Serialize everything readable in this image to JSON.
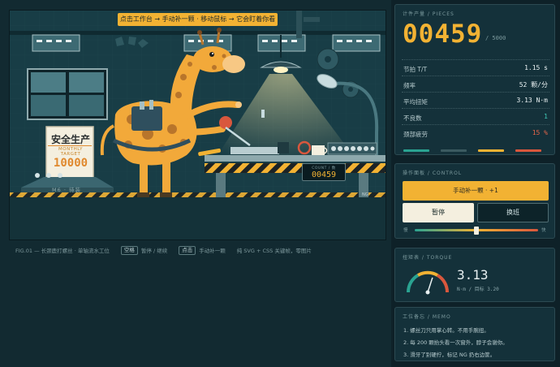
{
  "banner": {
    "text": "点击工作台 → 手动补一颗 · 移动鼠标 → 它会盯着你看"
  },
  "scene": {
    "sign_title": "安全生产",
    "sign_subtitle": "MONTHLY TARGET",
    "sign_number": "10000",
    "cart_label": "M6 · 待装",
    "count_label": "COUNT / 数",
    "count_value": "00459",
    "ng_label": "NG"
  },
  "caption": {
    "figure": "FIG.01 — 长颈鹿打螺丝 · 单轴流水工位",
    "key1": "空格",
    "action1": "暂停 / 继续",
    "key2": "点击",
    "action2": "手动补一颗",
    "note": "纯 SVG + CSS 关键帧，零图片"
  },
  "pieces": {
    "title": "计件产量 / PIECES",
    "value": "00459",
    "target": "/ 5000",
    "stats": [
      {
        "label": "节拍 T/T",
        "value": "1.15 s",
        "tone": "normal"
      },
      {
        "label": "频率",
        "value": "52 颗/分",
        "tone": "normal"
      },
      {
        "label": "平均扭矩",
        "value": "3.13 N·m",
        "tone": "normal"
      },
      {
        "label": "不良数",
        "value": "1",
        "tone": "teal"
      },
      {
        "label": "颈部疲劳",
        "value": "15 %",
        "tone": "red"
      }
    ],
    "legend_colors": [
      "#2aa391",
      "#3b5a60",
      "#f2b233",
      "#d9573d"
    ]
  },
  "control": {
    "title": "操作面板 / CONTROL",
    "manual_button": "手动补一颗 · +1",
    "pause_button": "暂停",
    "shift_button": "换班",
    "slow_label": "慢",
    "fast_label": "快",
    "speed_fraction": 0.5
  },
  "torque": {
    "title": "扭矩表 / TORQUE",
    "value": "3.13",
    "unit": "N·m / 目标 3.20",
    "gauge_fraction": 0.6
  },
  "memo": {
    "title": "工位备忘 / MEMO",
    "lines": [
      "1. 螺丝刀只用掌心转。不用手腕扭。",
      "2. 每 200 颗抬头看一次窗外，脖子会谢你。",
      "3. 滑牙了别硬拧，标记 NG 扔右边筐。"
    ]
  },
  "colors": {
    "accent": "#f2b233",
    "teal": "#2aa391",
    "alert": "#d9573d",
    "background": "#0e2128"
  }
}
